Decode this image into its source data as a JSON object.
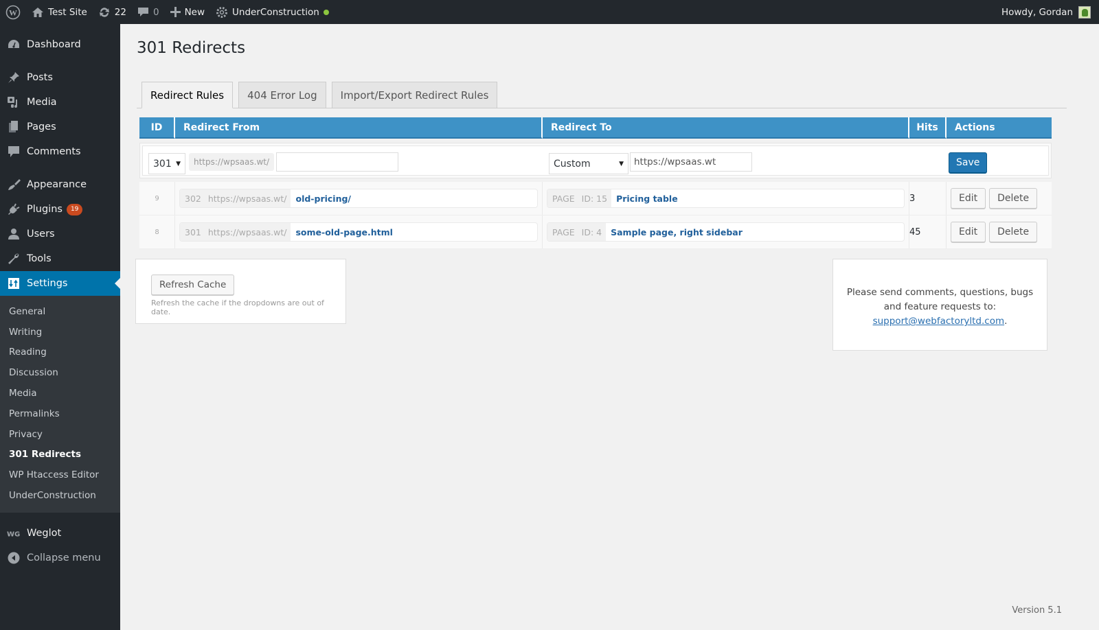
{
  "adminbar": {
    "site_name": "Test Site",
    "updates_count": "22",
    "comments_count": "0",
    "new_label": "New",
    "plugin_label": "UnderConstruction",
    "howdy": "Howdy, Gordan"
  },
  "sidebar": {
    "items": [
      {
        "label": "Dashboard",
        "icon": "dashboard-icon"
      },
      {
        "label": "Posts",
        "icon": "pin-icon"
      },
      {
        "label": "Media",
        "icon": "media-icon"
      },
      {
        "label": "Pages",
        "icon": "pages-icon"
      },
      {
        "label": "Comments",
        "icon": "comment-icon"
      },
      {
        "label": "Appearance",
        "icon": "brush-icon"
      },
      {
        "label": "Plugins",
        "icon": "plug-icon",
        "badge": "19"
      },
      {
        "label": "Users",
        "icon": "user-icon"
      },
      {
        "label": "Tools",
        "icon": "wrench-icon"
      },
      {
        "label": "Settings",
        "icon": "settings-icon"
      }
    ],
    "submenu": [
      "General",
      "Writing",
      "Reading",
      "Discussion",
      "Media",
      "Permalinks",
      "Privacy",
      "301 Redirects",
      "WP Htaccess Editor",
      "UnderConstruction"
    ],
    "weglot": "Weglot",
    "collapse": "Collapse menu"
  },
  "page": {
    "title": "301 Redirects",
    "tabs": [
      "Redirect Rules",
      "404 Error Log",
      "Import/Export Redirect Rules"
    ]
  },
  "table": {
    "headers": {
      "id": "ID",
      "from": "Redirect From",
      "to": "Redirect To",
      "hits": "Hits",
      "actions": "Actions"
    },
    "new_rule": {
      "status": "301",
      "prefix": "https://wpsaas.wt/",
      "from_value": "",
      "to_type": "Custom",
      "to_value": "https://wpsaas.wt",
      "save_label": "Save"
    },
    "rows": [
      {
        "id": "9",
        "status": "302",
        "prefix": "https://wpsaas.wt/",
        "from": "old-pricing/",
        "to_type": "PAGE",
        "to_id": "ID: 15",
        "to": "Pricing table",
        "hits": "3"
      },
      {
        "id": "8",
        "status": "301",
        "prefix": "https://wpsaas.wt/",
        "from": "some-old-page.html",
        "to_type": "PAGE",
        "to_id": "ID: 4",
        "to": "Sample page, right sidebar",
        "hits": "45"
      }
    ],
    "edit_label": "Edit",
    "delete_label": "Delete"
  },
  "cache": {
    "button": "Refresh Cache",
    "hint": "Refresh the cache if the dropdowns are out of date."
  },
  "support": {
    "line1": "Please send comments, questions, bugs",
    "line2": "and feature requests to:",
    "email": "support@webfactoryltd.com",
    "trail": "."
  },
  "footer": {
    "version": "Version 5.1"
  }
}
